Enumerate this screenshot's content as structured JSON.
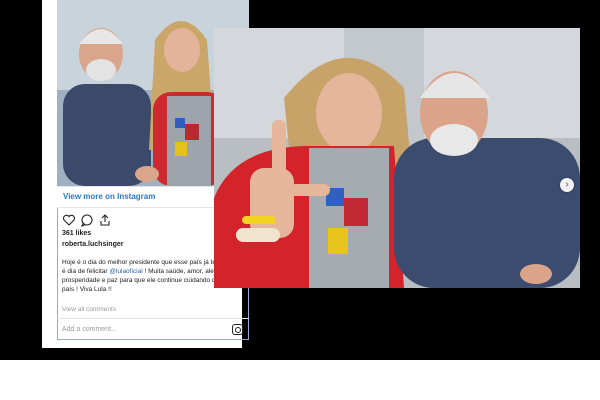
{
  "instagram": {
    "view_more": "View more on Instagram",
    "likes": "361 likes",
    "username": "roberta.luchsinger",
    "caption_part1": "Hoje é o dia do melhor presidente que esse país já teve, hoje é dia de felicitar",
    "caption_mention": "@lulaoficial",
    "caption_part2": "! Muita saúde, amor, alegria, luz, prosperidade e paz para que ele continue cuidando do nosso país ! Viva Lula !!",
    "view_comments": "View all comments",
    "comment_placeholder": "Add a comment...",
    "icons": [
      "heart-icon",
      "comment-icon",
      "share-icon",
      "bookmark-icon",
      "instagram-logo-icon"
    ]
  },
  "carousel": {
    "next_icon": "chevron-right-icon"
  },
  "colors": {
    "link_blue": "#2d77c9",
    "jacket_red": "#d4232b",
    "shirt_navy": "#3d4d6e"
  }
}
